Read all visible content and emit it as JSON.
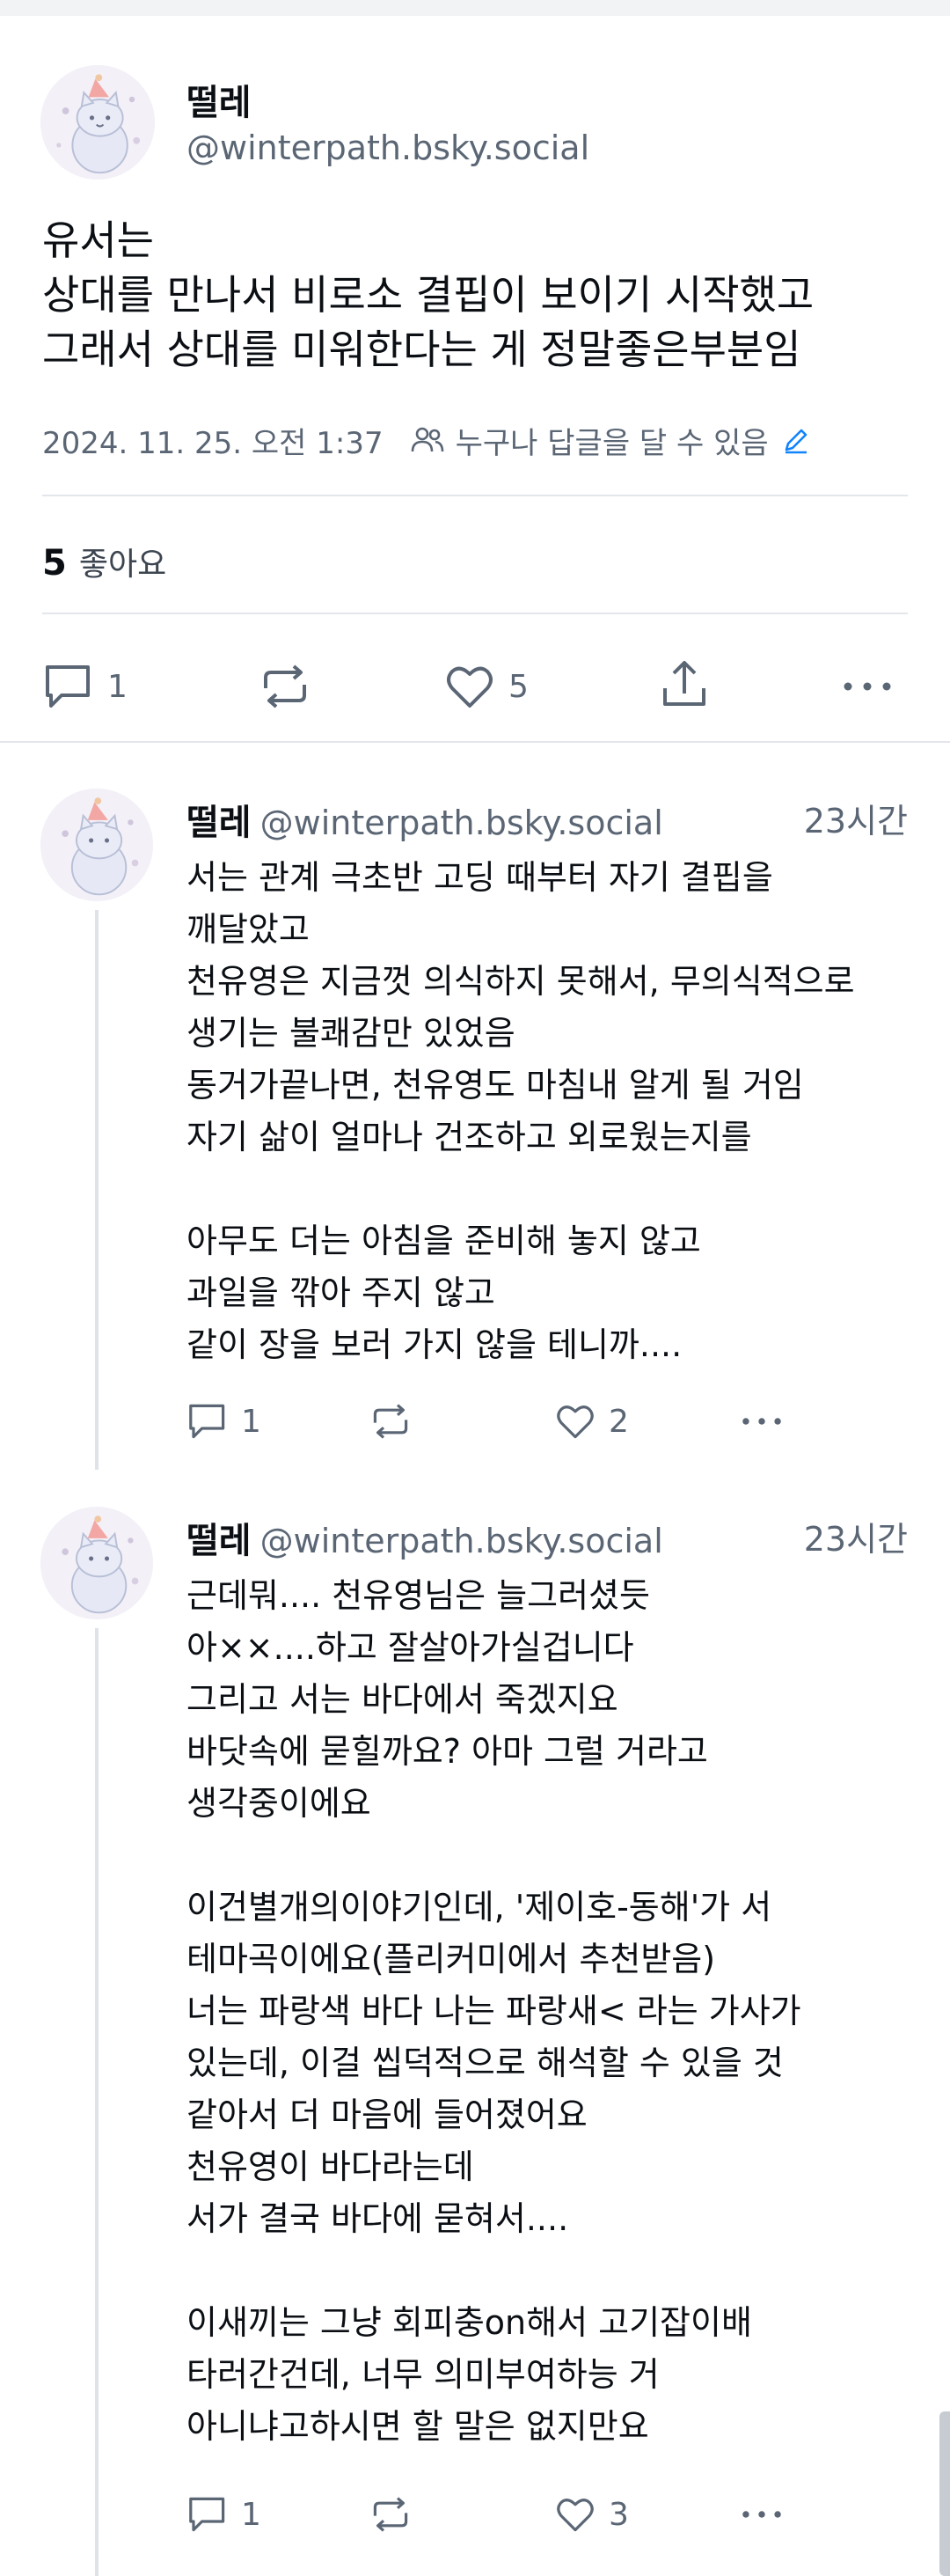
{
  "post": {
    "author_name": "떨레",
    "author_handle": "@winterpath.bsky.social",
    "text": "유서는\n상대를 만나서 비로소 결핍이 보이기 시작했고\n그래서 상대를 미워한다는 게 정말좋은부분임",
    "date": "2024. 11. 25. 오전 1:37",
    "reply_setting": "누구나 답글을 달 수 있음",
    "like_count": "5",
    "like_label": "좋아요",
    "actions": {
      "reply_count": "1",
      "like_count": "5"
    }
  },
  "replies": [
    {
      "author_name": "떨레",
      "author_handle": "@winterpath.bsky.social",
      "time": "23시간",
      "text": "서는 관계 극초반 고딩 때부터 자기 결핍을\n깨달았고\n천유영은 지금껏 의식하지 못해서, 무의식적으로\n생기는 불쾌감만 있었음\n동거가끝나면, 천유영도 마침내 알게 될 거임\n자기 삶이 얼마나 건조하고 외로웠는지를\n\n아무도 더는 아침을 준비해 놓지 않고\n과일을 깎아 주지 않고\n같이 장을 보러 가지 않을 테니까....",
      "reply_count": "1",
      "like_count": "2"
    },
    {
      "author_name": "떨레",
      "author_handle": "@winterpath.bsky.social",
      "time": "23시간",
      "text": "근데뭐.... 천유영님은 늘그러셨듯\n아××....하고 잘살아가실겁니다\n그리고 서는 바다에서 죽겠지요\n바닷속에 묻힐까요? 아마 그럴 거라고\n생각중이에요\n\n이건별개의이야기인데, '제이호-동해'가 서\n테마곡이에요(플리커미에서 추천받음)\n너는 파랑색 바다 나는 파랑새< 라는 가사가\n있는데, 이걸 씹덕적으로 해석할 수 있을 것\n같아서 더 마음에 들어졌어요\n천유영이 바다라는데\n서가 결국 바다에 묻혀서....\n\n이새끼는 그냥 회피충on해서 고기잡이배\n타러간건데, 너무 의미부여하능 거\n아니냐고하시면 할 말은 없지만요",
      "reply_count": "1",
      "like_count": "3"
    }
  ],
  "colors": {
    "text": "#0b0f14",
    "muted": "#5b6675",
    "accent": "#1083fe",
    "divider": "#e3e6ea"
  },
  "icons": [
    "reply-icon",
    "repost-icon",
    "like-icon",
    "share-icon",
    "more-icon",
    "people-icon",
    "pencil-icon"
  ]
}
